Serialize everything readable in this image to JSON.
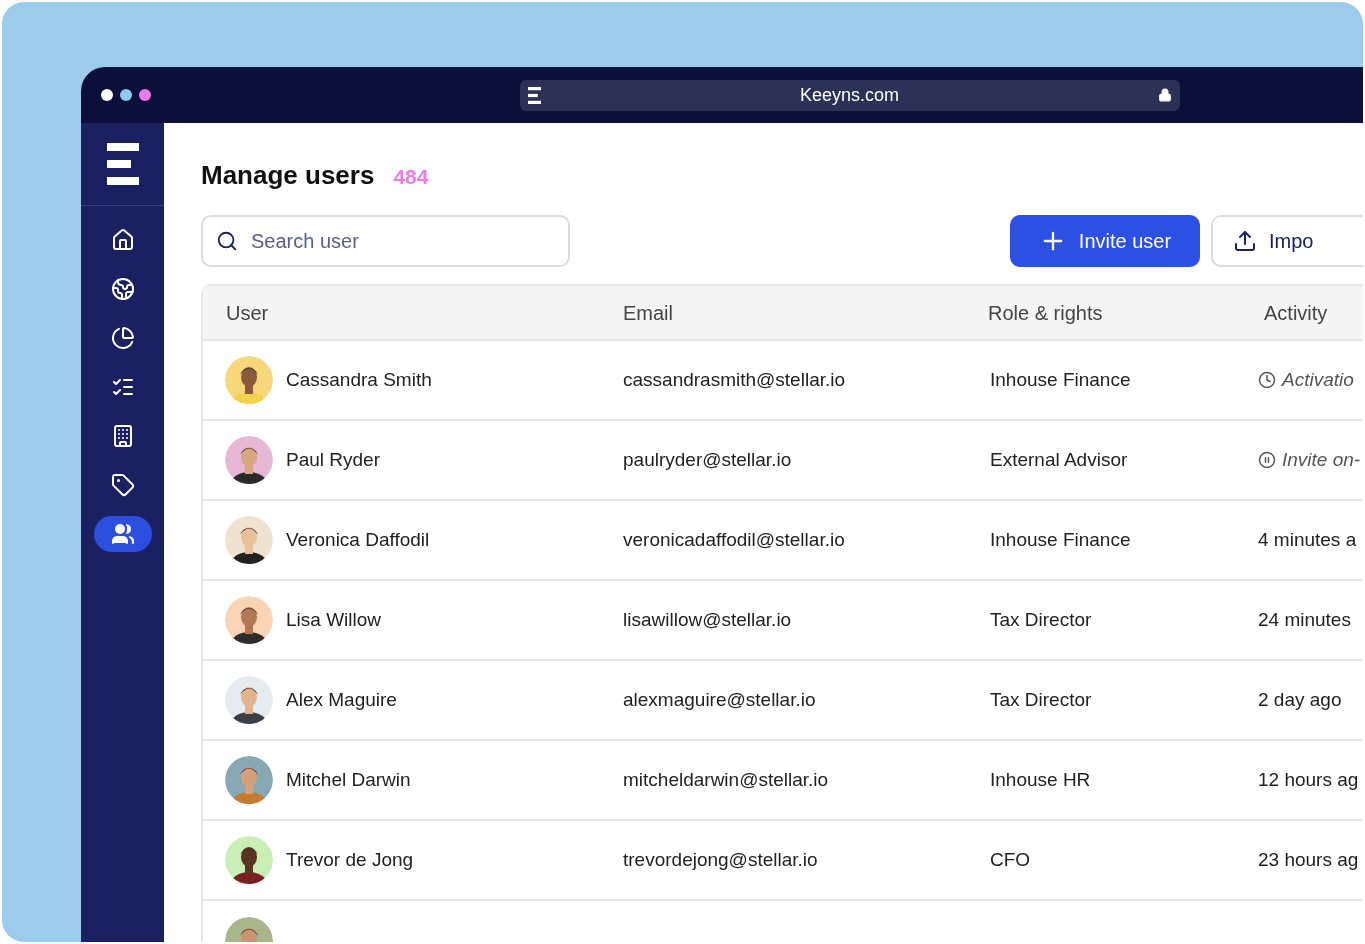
{
  "browser": {
    "dots": [
      {
        "color": "#ffffff"
      },
      {
        "color": "#8ec9ee"
      },
      {
        "color": "#ee7ae6"
      }
    ],
    "url": "Keeyns.com"
  },
  "sidebar": {
    "items": [
      {
        "kind": "home",
        "selected": false
      },
      {
        "kind": "globe",
        "selected": false
      },
      {
        "kind": "pie",
        "selected": false
      },
      {
        "kind": "checklist",
        "selected": false
      },
      {
        "kind": "building",
        "selected": false
      },
      {
        "kind": "tag",
        "selected": false
      },
      {
        "kind": "users",
        "selected": true
      }
    ]
  },
  "header": {
    "title": "Manage users",
    "count": "484"
  },
  "search": {
    "placeholder": "Search user"
  },
  "actions": [
    {
      "kind": "primary",
      "label": "Invite user"
    },
    {
      "kind": "secondary",
      "label": "Impo"
    }
  ],
  "table": {
    "columns": [
      "User",
      "Email",
      "Role & rights",
      "Activity"
    ],
    "rows": [
      {
        "name": "Cassandra Smith",
        "email": "cassandrasmith@stellar.io",
        "role": "Inhouse Finance",
        "activity": {
          "kind": "pending",
          "text": "Activatio"
        }
      },
      {
        "name": "Paul Ryder",
        "email": "paulryder@stellar.io",
        "role": "External Advisor",
        "activity": {
          "kind": "paused",
          "text": "Invite on-"
        }
      },
      {
        "name": "Veronica Daffodil",
        "email": "veronicadaffodil@stellar.io",
        "role": "Inhouse Finance",
        "activity": {
          "kind": "plain",
          "text": "4 minutes a"
        }
      },
      {
        "name": "Lisa Willow",
        "email": "lisawillow@stellar.io",
        "role": "Tax Director",
        "activity": {
          "kind": "plain",
          "text": "24 minutes"
        }
      },
      {
        "name": "Alex Maguire",
        "email": "alexmaguire@stellar.io",
        "role": "Tax Director",
        "activity": {
          "kind": "plain",
          "text": "2 day ago"
        }
      },
      {
        "name": "Mitchel Darwin",
        "email": "mitcheldarwin@stellar.io",
        "role": "Inhouse HR",
        "activity": {
          "kind": "plain",
          "text": "12 hours ag"
        }
      },
      {
        "name": "Trevor de Jong",
        "email": "trevordejong@stellar.io",
        "role": "CFO",
        "activity": {
          "kind": "plain",
          "text": "23 hours ag"
        }
      }
    ],
    "cut_row": true
  }
}
